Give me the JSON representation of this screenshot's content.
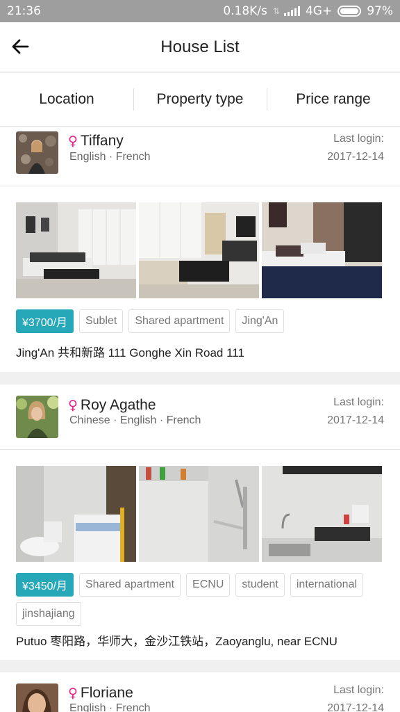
{
  "status_bar": {
    "time": "21:36",
    "network_speed": "0.18K/s",
    "network_type": "4G+",
    "battery": "97%"
  },
  "app_bar": {
    "title": "House List",
    "back_icon": "back-arrow-icon"
  },
  "filters": [
    {
      "label": "Location"
    },
    {
      "label": "Property type"
    },
    {
      "label": "Price range"
    }
  ],
  "listings": [
    {
      "gender_symbol": "♀",
      "name": "Tiffany",
      "languages": "English · French",
      "last_login_label": "Last login:",
      "last_login_date": "2017-12-14",
      "price": "¥3700/月",
      "tags": [
        "Sublet",
        "Shared apartment",
        "Jing'An"
      ],
      "address": "Jing'An 共和新路 111 Gonghe Xin Road 111"
    },
    {
      "gender_symbol": "♀",
      "name": "Roy Agathe",
      "languages": "Chinese · English · French",
      "last_login_label": "Last login:",
      "last_login_date": "2017-12-14",
      "price": "¥3450/月",
      "tags": [
        "Shared apartment",
        "ECNU",
        "student",
        "international",
        "jinshajiang"
      ],
      "address": "Putuo 枣阳路，华师大，金沙江铁站，Zaoyanglu, near ECNU"
    },
    {
      "gender_symbol": "♀",
      "name": "Floriane",
      "languages": "English · French",
      "last_login_label": "Last login:",
      "last_login_date": "2017-12-14"
    }
  ],
  "colors": {
    "accent": "#27a8b8",
    "gender": "#e6208a",
    "status_bar": "#9e9e9e"
  }
}
